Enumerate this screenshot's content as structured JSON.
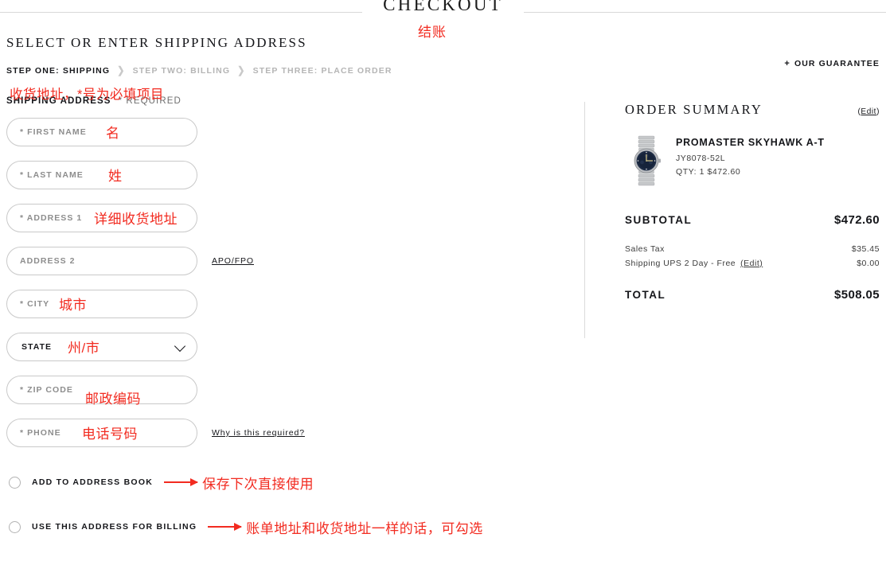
{
  "header": {
    "title": "CHECKOUT",
    "title_annotation": "结账"
  },
  "left": {
    "section_heading": "SELECT OR ENTER SHIPPING ADDRESS",
    "steps": [
      {
        "label": "STEP ONE: SHIPPING",
        "active": true
      },
      {
        "label": "STEP TWO: BILLING",
        "active": false
      },
      {
        "label": "STEP THREE: PLACE ORDER",
        "active": false
      }
    ],
    "step_separator": "❯",
    "shipping_address_label": "SHIPPING ADDRESS",
    "required_note": "* REQUIRED",
    "shipping_annotation": "收货地址，*号为必填项目",
    "fields": [
      {
        "label": "* FIRST NAME",
        "annotation": "名",
        "link": "",
        "type": "text"
      },
      {
        "label": "* LAST NAME",
        "annotation": "姓",
        "link": "",
        "type": "text"
      },
      {
        "label": "* ADDRESS 1",
        "annotation": "详细收货地址",
        "link": "",
        "type": "text"
      },
      {
        "label": "ADDRESS 2",
        "annotation": "",
        "link": "APO/FPO",
        "type": "text"
      },
      {
        "label": "* CITY",
        "annotation": "城市",
        "link": "",
        "type": "text"
      },
      {
        "label": "STATE",
        "annotation": "州/市",
        "link": "",
        "type": "select"
      },
      {
        "label": "* ZIP CODE",
        "annotation": "邮政编码",
        "link": "",
        "type": "text"
      },
      {
        "label": "* PHONE",
        "annotation": "电话号码",
        "link": "Why is this required?",
        "type": "text"
      }
    ],
    "checkboxes": [
      {
        "label": "ADD TO ADDRESS BOOK",
        "annotation": "保存下次直接使用"
      },
      {
        "label": "USE THIS ADDRESS FOR BILLING",
        "annotation": "账单地址和收货地址一样的话，可勾选"
      }
    ]
  },
  "right": {
    "guarantee_toggle": "+",
    "guarantee_label": "OUR GUARANTEE",
    "summary_title": "ORDER SUMMARY",
    "summary_edit": "Edit",
    "product": {
      "name": "PROMASTER SKYHAWK A-T",
      "sku": "JY8078-52L",
      "qty_price": "QTY: 1  $472.60"
    },
    "subtotal_label": "SUBTOTAL",
    "subtotal_value": "$472.60",
    "lines": [
      {
        "label": "Sales Tax",
        "value": "$35.45",
        "edit": ""
      },
      {
        "label": "Shipping UPS 2 Day - Free",
        "value": "$0.00",
        "edit": "(Edit)"
      }
    ],
    "total_label": "TOTAL",
    "total_value": "$508.05"
  },
  "colors": {
    "annotation_red": "#f22b20",
    "text_dark": "#15161a",
    "muted": "#8d8d8d",
    "border": "#c9c9c9"
  }
}
